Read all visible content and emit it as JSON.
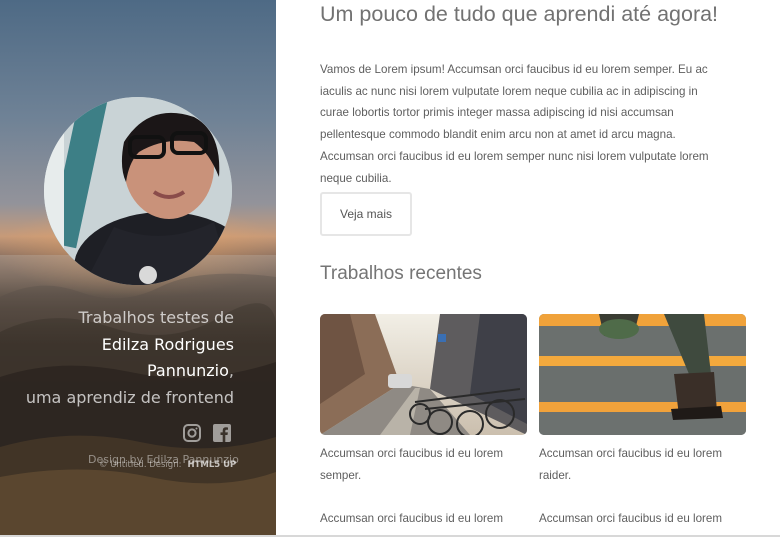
{
  "sidebar": {
    "intro_line1": "Trabalhos testes de",
    "intro_name": "Edilza Rodrigues Pannunzio",
    "intro_line3": "uma aprendiz de frontend",
    "social_icons": [
      "instagram-icon",
      "facebook-icon"
    ],
    "credits": "Design by Edilza Pannunzio",
    "credits_copy": "© Untitled. Design:",
    "credits_link": "HTML5 UP"
  },
  "main": {
    "headline": "Um pouco de tudo que aprendi até agora!",
    "lead": "Vamos de Lorem ipsum! Accumsan orci faucibus id eu lorem semper. Eu ac iaculis ac nunc nisi lorem vulputate lorem neque cubilia ac in adipiscing in curae lobortis tortor primis integer massa adipiscing id nisi accumsan pellentesque commodo blandit enim arcu non at amet id arcu magna. Accumsan orci faucibus id eu lorem semper nunc nisi lorem vulputate lorem neque cubilia.",
    "more_button": "Veja mais",
    "section_title": "Trabalhos recentes",
    "works": [
      {
        "caption": "Accumsan orci faucibus id eu lorem semper."
      },
      {
        "caption": "Accumsan orci faucibus id eu lorem raider."
      }
    ],
    "works_row2": [
      {
        "caption": "Accumsan orci faucibus id eu lorem"
      },
      {
        "caption": "Accumsan orci faucibus id eu lorem"
      }
    ]
  },
  "colors": {
    "text": "#5e5e5e",
    "heading": "#727272",
    "button_border": "#e6e6e6"
  }
}
